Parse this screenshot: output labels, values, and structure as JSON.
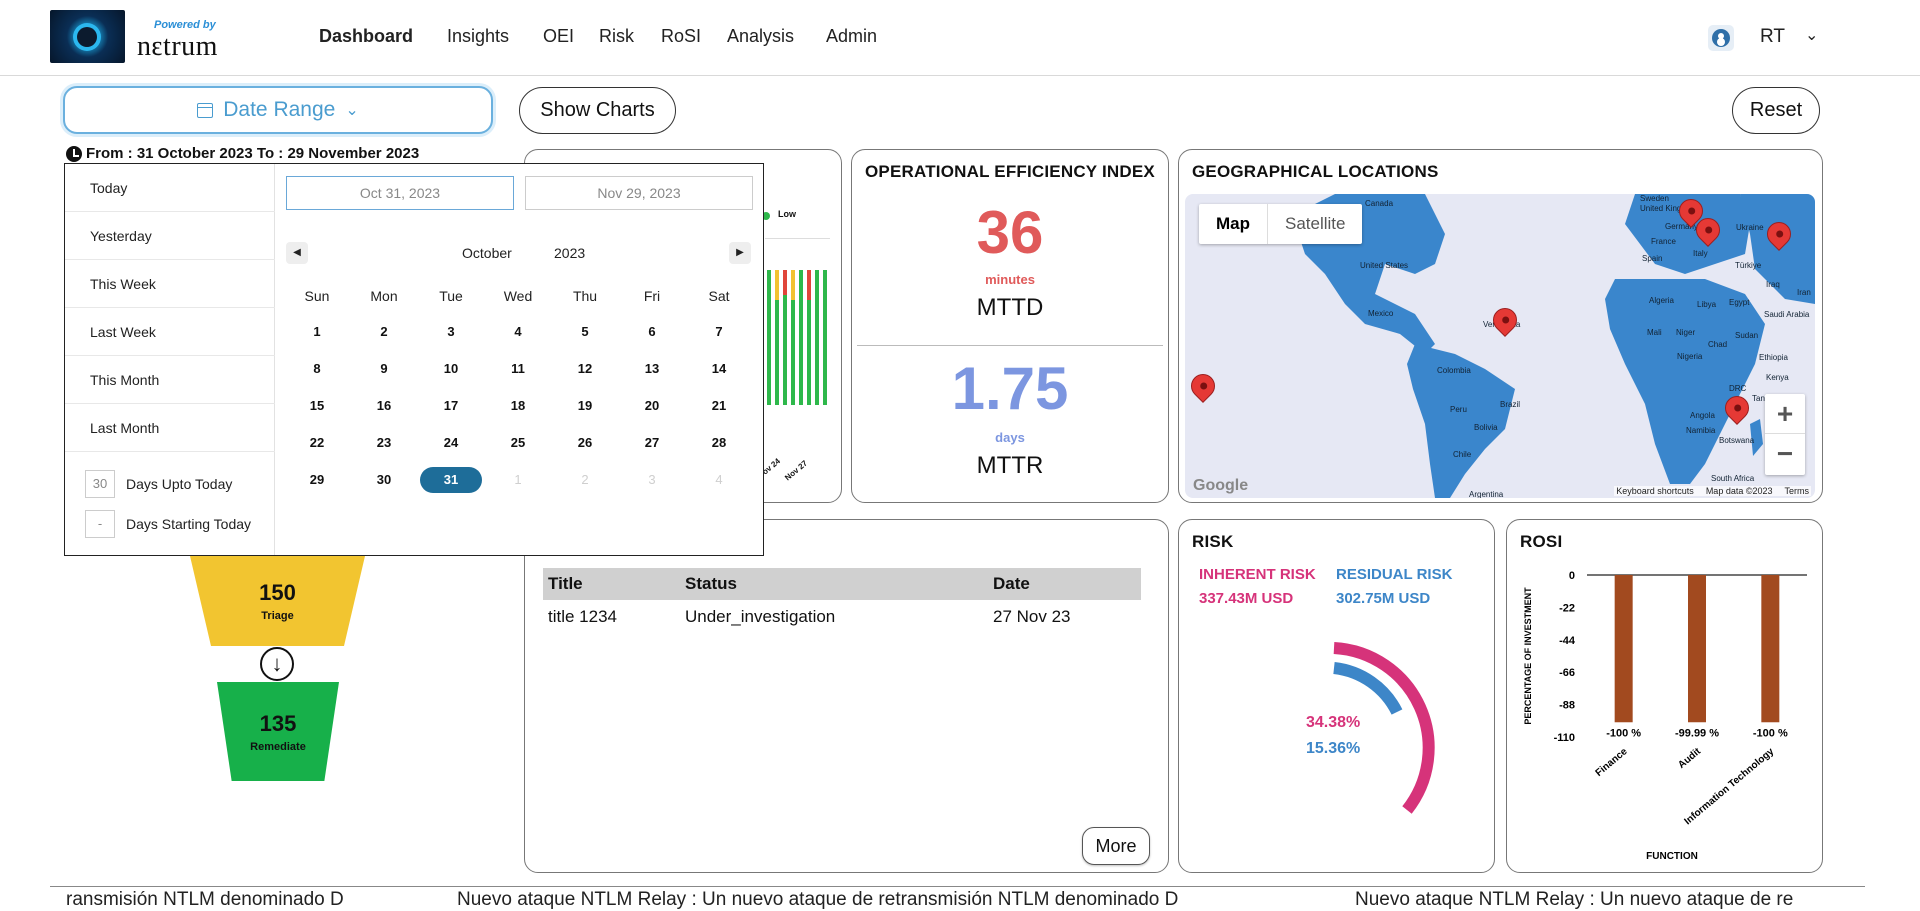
{
  "header": {
    "powered_by": "Powered by",
    "brand": "nԑtrum",
    "nav": [
      "Dashboard",
      "Insights",
      "OEI",
      "Risk",
      "RoSI",
      "Analysis",
      "Admin"
    ],
    "user_initials": "RT"
  },
  "controls": {
    "date_range_label": "Date Range",
    "show_charts_label": "Show Charts",
    "reset_label": "Reset",
    "range_text": "From : 31 October 2023 To : 29 November 2023"
  },
  "datepicker": {
    "presets": [
      "Today",
      "Yesterday",
      "This Week",
      "Last Week",
      "This Month",
      "Last Month"
    ],
    "days_upto_value": "30",
    "days_upto_label": "Days Upto Today",
    "days_starting_value": "-",
    "days_starting_label": "Days Starting Today",
    "start_date": "Oct 31, 2023",
    "end_date": "Nov 29, 2023",
    "month": "October",
    "year": "2023",
    "weekdays": [
      "Sun",
      "Mon",
      "Tue",
      "Wed",
      "Thu",
      "Fri",
      "Sat"
    ],
    "weeks": [
      [
        "1",
        "2",
        "3",
        "4",
        "5",
        "6",
        "7"
      ],
      [
        "8",
        "9",
        "10",
        "11",
        "12",
        "13",
        "14"
      ],
      [
        "15",
        "16",
        "17",
        "18",
        "19",
        "20",
        "21"
      ],
      [
        "22",
        "23",
        "24",
        "25",
        "26",
        "27",
        "28"
      ],
      [
        "29",
        "30",
        "31",
        "1",
        "2",
        "3",
        "4"
      ]
    ],
    "selected_day": "31"
  },
  "hidden_chart": {
    "legend_low": "Low",
    "tick_labels": [
      "ov 24",
      "Nov 27"
    ],
    "colors": {
      "green": "#2eb84b",
      "yellow": "#f2c230",
      "red": "#e0453a"
    }
  },
  "oei": {
    "title": "OPERATIONAL EFFICIENCY INDEX",
    "mttd_value": "36",
    "mttd_unit": "minutes",
    "mttd_label": "MTTD",
    "mttr_value": "1.75",
    "mttr_unit": "days",
    "mttr_label": "MTTR"
  },
  "geo": {
    "title": "GEOGRAPHICAL LOCATIONS",
    "tab_map": "Map",
    "tab_satellite": "Satellite",
    "zoom_in": "+",
    "zoom_out": "−",
    "google": "Google",
    "footer": [
      "Keyboard shortcuts",
      "Map data ©2023",
      "Terms"
    ],
    "countries": [
      "Canada",
      "United States",
      "Mexico",
      "Venezuela",
      "Colombia",
      "Brazil",
      "Peru",
      "Bolivia",
      "Chile",
      "Argentina",
      "Sweden",
      "United Kingdom",
      "Germany",
      "France",
      "Ukraine",
      "Spain",
      "Italy",
      "Türkiye",
      "Iraq",
      "Iran",
      "Algeria",
      "Libya",
      "Egypt",
      "Saudi Arabia",
      "Mali",
      "Niger",
      "Sudan",
      "Chad",
      "Nigeria",
      "Ethiopia",
      "Kenya",
      "DRC",
      "Tanzania",
      "Angola",
      "Namibia",
      "Botswana",
      "South Africa"
    ]
  },
  "incidents": {
    "columns": [
      "Title",
      "Status",
      "Date"
    ],
    "rows": [
      [
        "title 1234",
        "Under_investigation",
        "27 Nov 23"
      ]
    ],
    "more_label": "More"
  },
  "risk": {
    "title": "RISK",
    "inherent_label": "INHERENT RISK",
    "inherent_value": "337.43M USD",
    "residual_label": "RESIDUAL RISK",
    "residual_value": "302.75M USD",
    "inherent_pct": "34.38%",
    "residual_pct": "15.36%",
    "colors": {
      "inherent": "#d6337a",
      "residual": "#3d86c8"
    }
  },
  "funnel": {
    "triage_value": "150",
    "triage_label": "Triage",
    "remediate_value": "135",
    "remediate_label": "Remediate",
    "colors": {
      "triage": "#f2c530",
      "remediate": "#17b04a"
    }
  },
  "chart_data": {
    "type": "bar",
    "title": "ROSI",
    "xlabel": "FUNCTION",
    "ylabel": "PERCENTAGE OF INVESTMENT",
    "categories": [
      "Finance",
      "Audit",
      "Information Technology"
    ],
    "values": [
      -100,
      -99.99,
      -100
    ],
    "value_labels": [
      "-100 %",
      "-99.99 %",
      "-100 %"
    ],
    "yticks": [
      0,
      -22,
      -44,
      -66,
      -88,
      -110
    ],
    "ylim": [
      -110,
      0
    ],
    "grid": false,
    "bar_color": "#a24a1f"
  },
  "ticker": {
    "segments": [
      "ransmisión NTLM denominado D",
      "Nuevo ataque NTLM Relay : Un nuevo ataque de retransmisión NTLM denominado D",
      "Nuevo ataque NTLM Relay : Un nuevo ataque de re"
    ]
  }
}
